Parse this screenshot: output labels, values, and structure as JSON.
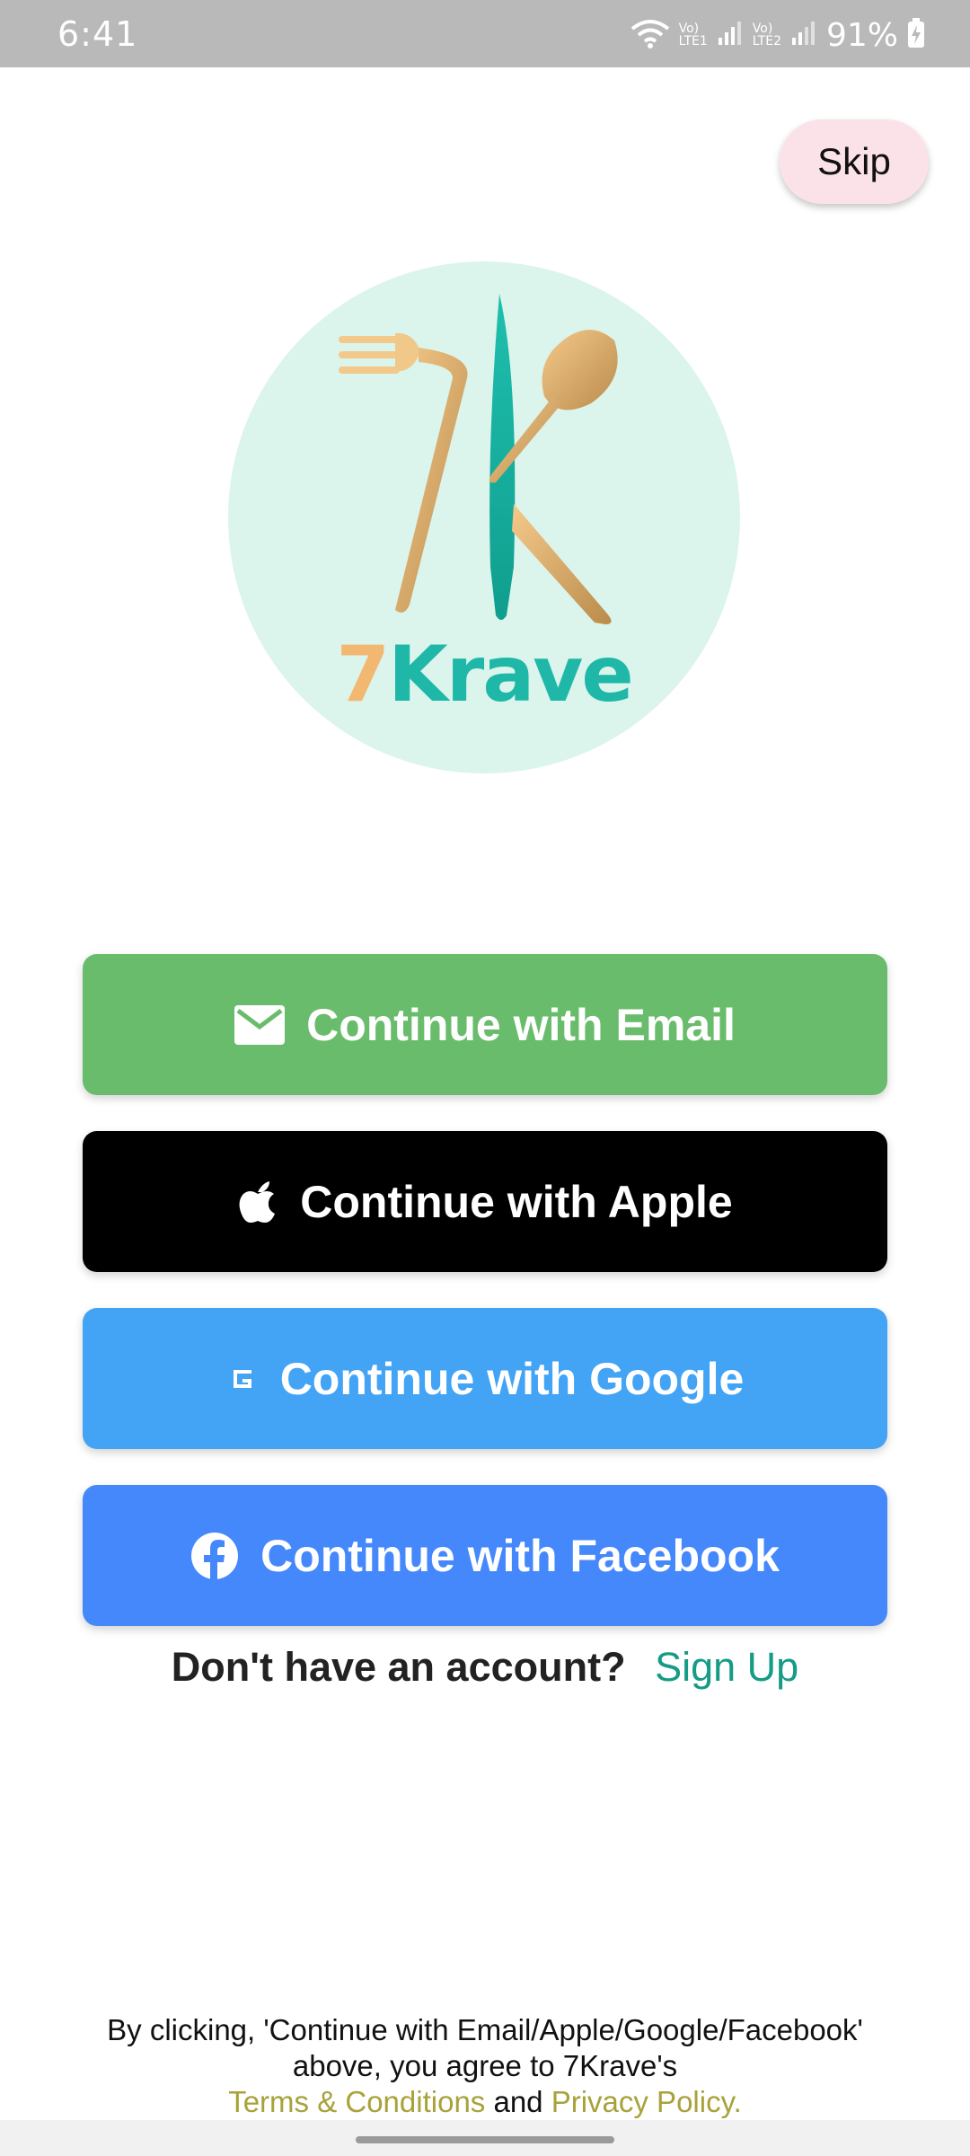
{
  "status_bar": {
    "time": "6:41",
    "network1_top": "Vo)",
    "network1_bottom": "LTE1",
    "network2_top": "Vo)",
    "network2_bottom": "LTE2",
    "battery": "91%"
  },
  "skip_label": "Skip",
  "logo": {
    "seven": "7",
    "krave": "Krave"
  },
  "buttons": {
    "email": "Continue with Email",
    "apple": "Continue with Apple",
    "google": "Continue with Google",
    "facebook": "Continue with Facebook"
  },
  "signup": {
    "question": "Don't have an account?",
    "link": "Sign Up"
  },
  "legal": {
    "line1": "By clicking, 'Continue with Email/Apple/Google/Facebook'",
    "line2": "above, you agree to 7Krave's",
    "terms": "Terms & Conditions",
    "and": "and",
    "privacy": "Privacy Policy."
  },
  "colors": {
    "email_button": "#69bc6b",
    "apple_button": "#000000",
    "google_button": "#43a3f5",
    "facebook_button": "#4588fb",
    "accent_link": "#159b86",
    "legal_link": "#a8a23a",
    "skip_bg": "#fbe2e8",
    "logo_bg": "#dbf4ec"
  },
  "icons": {
    "email": "envelope-icon",
    "apple": "apple-icon",
    "google": "google-icon",
    "facebook": "facebook-icon"
  }
}
